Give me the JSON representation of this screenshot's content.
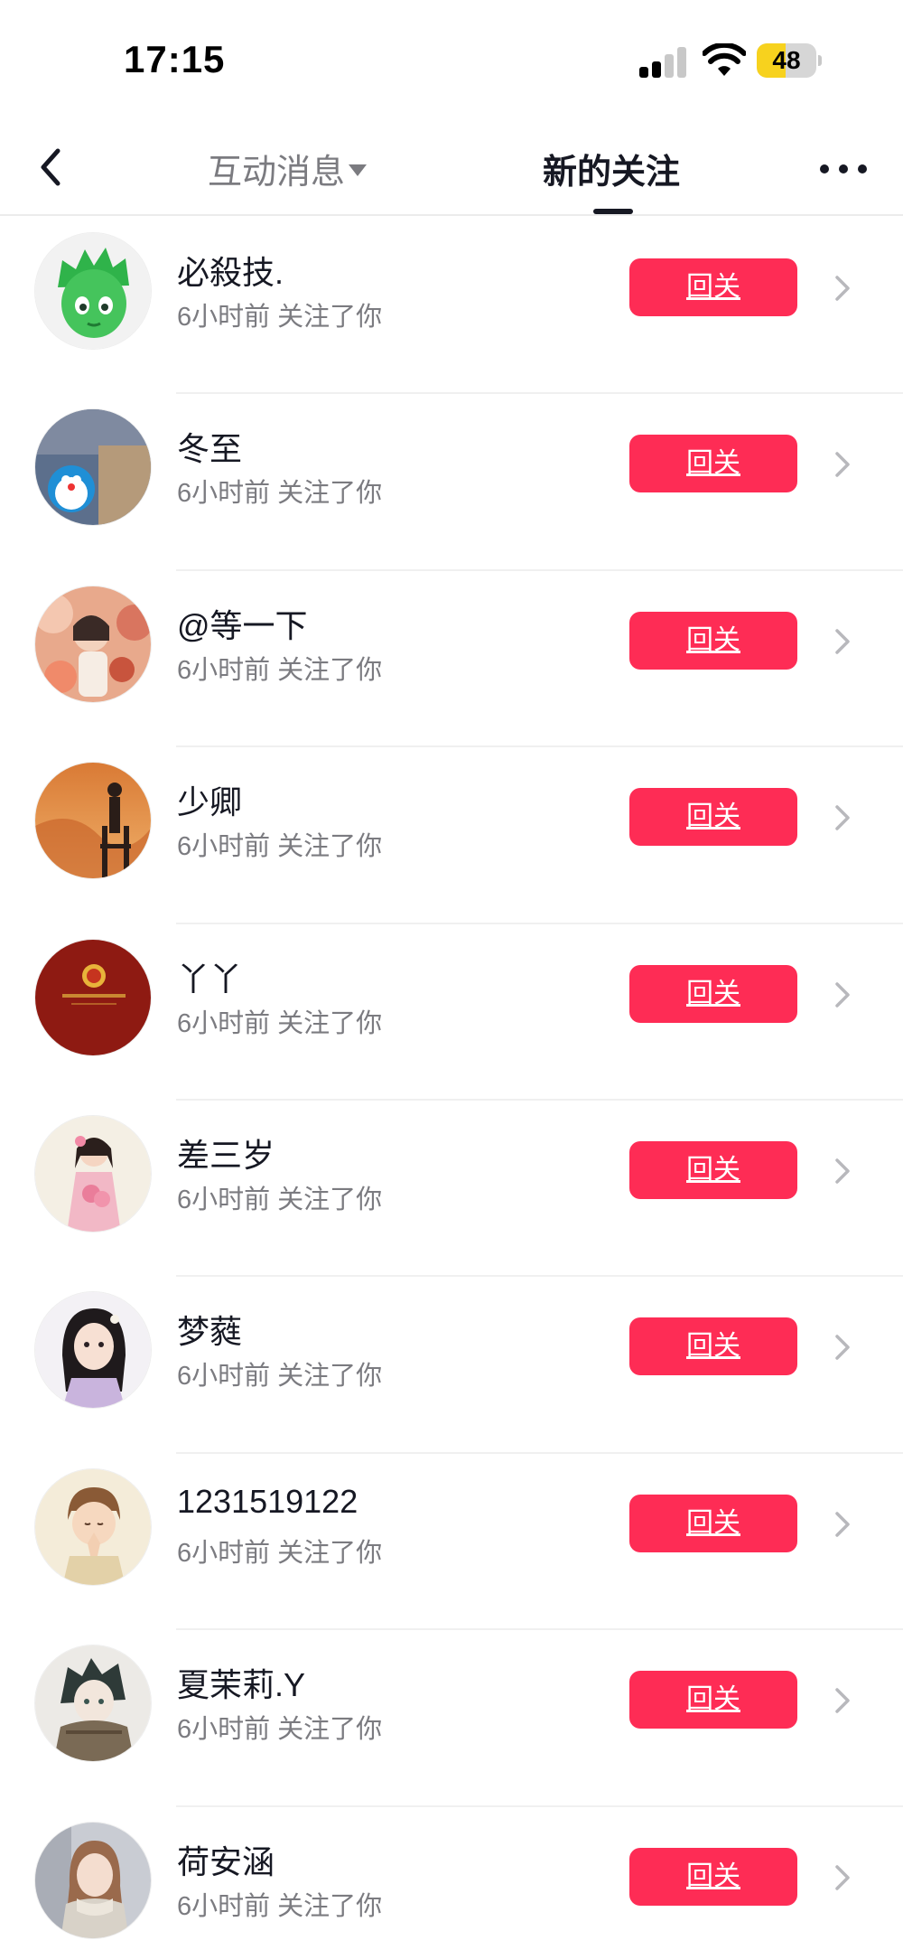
{
  "status_bar": {
    "time": "17:15",
    "battery_level": 48
  },
  "nav": {
    "tabs": [
      {
        "label": "互动消息",
        "active": false,
        "has_dropdown": true
      },
      {
        "label": "新的关注",
        "active": true
      }
    ]
  },
  "colors": {
    "accent": "#fe2c55",
    "text_primary": "#161823",
    "text_secondary": "#7b7b80",
    "battery_fill": "#f7d21e"
  },
  "followers": [
    {
      "name": "必殺技.",
      "info": "6小时前 关注了你",
      "action": "回关",
      "avatar": "green-mascot-avatar"
    },
    {
      "name": "冬至",
      "info": "6小时前 关注了你",
      "action": "回关",
      "avatar": "doraemon-avatar"
    },
    {
      "name": "@等一下",
      "info": "6小时前 关注了你",
      "action": "回关",
      "avatar": "girl-flowers-avatar"
    },
    {
      "name": "少卿",
      "info": "6小时前 关注了你",
      "action": "回关",
      "avatar": "silhouette-sunset-avatar"
    },
    {
      "name": "丫丫",
      "info": "6小时前 关注了你",
      "action": "回关",
      "avatar": "red-emblem-avatar"
    },
    {
      "name": "差三岁",
      "info": "6小时前 关注了你",
      "action": "回关",
      "avatar": "girl-pink-dress-avatar"
    },
    {
      "name": "梦蕤",
      "info": "6小时前 关注了你",
      "action": "回关",
      "avatar": "anime-girl-avatar"
    },
    {
      "name": "1231519122",
      "info": "6小时前 关注了你",
      "action": "回关",
      "avatar": "praying-boy-avatar"
    },
    {
      "name": "夏茉莉.Y",
      "info": "6小时前 关注了你",
      "action": "回关",
      "avatar": "anime-boy-avatar"
    },
    {
      "name": "荷安涵",
      "info": "6小时前 关注了你",
      "action": "回关",
      "avatar": "girl-scarf-avatar"
    }
  ]
}
